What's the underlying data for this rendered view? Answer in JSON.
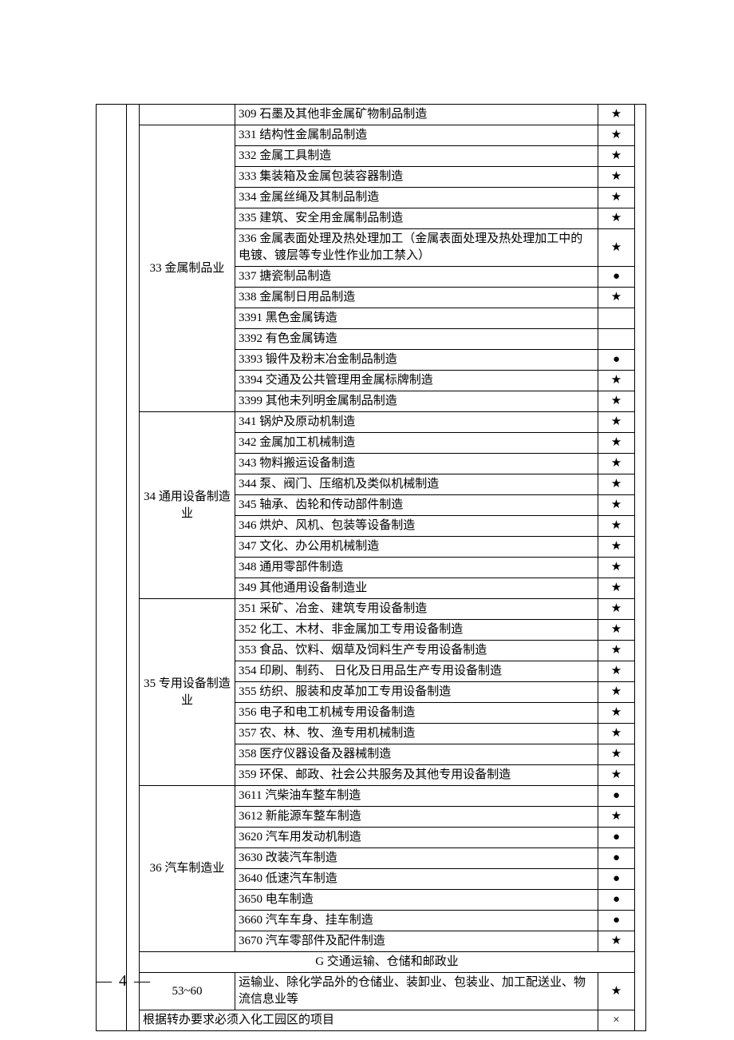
{
  "rows": [
    {
      "cat": "",
      "desc": "309 石墨及其他非金属矿物制品制造",
      "mark": "★"
    }
  ],
  "group33": {
    "label": "33  金属制品业",
    "items": [
      {
        "desc": "331 结构性金属制品制造",
        "mark": "★"
      },
      {
        "desc": "332 金属工具制造",
        "mark": "★"
      },
      {
        "desc": "333 集装箱及金属包装容器制造",
        "mark": "★"
      },
      {
        "desc": "334 金属丝绳及其制品制造",
        "mark": "★"
      },
      {
        "desc": "335 建筑、安全用金属制品制造",
        "mark": "★"
      },
      {
        "desc": "336 金属表面处理及热处理加工（金属表面处理及热处理加工中的电镀、镀层等专业性作业加工禁入）",
        "mark": "★"
      },
      {
        "desc": "337 搪瓷制品制造",
        "mark": "●"
      },
      {
        "desc": "338 金属制日用品制造",
        "mark": "★"
      },
      {
        "desc": "3391 黑色金属铸造",
        "mark": ""
      },
      {
        "desc": "3392 有色金属铸造",
        "mark": ""
      },
      {
        "desc": "3393 锻件及粉末冶金制品制造",
        "mark": "●"
      },
      {
        "desc": "3394 交通及公共管理用金属标牌制造",
        "mark": "★"
      },
      {
        "desc": "3399 其他未列明金属制品制造",
        "mark": "★"
      }
    ]
  },
  "group34": {
    "label": "34 通用设备制造业",
    "items": [
      {
        "desc": "341 锅炉及原动机制造",
        "mark": "★"
      },
      {
        "desc": "342 金属加工机械制造",
        "mark": "★"
      },
      {
        "desc": "343 物料搬运设备制造",
        "mark": "★"
      },
      {
        "desc": "344 泵、阀门、压缩机及类似机械制造",
        "mark": "★"
      },
      {
        "desc": "345 轴承、齿轮和传动部件制造",
        "mark": "★"
      },
      {
        "desc": "346 烘炉、风机、包装等设备制造",
        "mark": "★"
      },
      {
        "desc": "347 文化、办公用机械制造",
        "mark": "★"
      },
      {
        "desc": "348 通用零部件制造",
        "mark": "★"
      },
      {
        "desc": "349 其他通用设备制造业",
        "mark": "★"
      }
    ]
  },
  "group35": {
    "label": "35  专用设备制造业",
    "items": [
      {
        "desc": "351 采矿、冶金、建筑专用设备制造",
        "mark": "★"
      },
      {
        "desc": "352 化工、木材、非金属加工专用设备制造",
        "mark": "★"
      },
      {
        "desc": "353 食品、饮料、烟草及饲料生产专用设备制造",
        "mark": "★"
      },
      {
        "desc": "354 印刷、制药、 日化及日用品生产专用设备制造",
        "mark": "★"
      },
      {
        "desc": "355 纺织、服装和皮革加工专用设备制造",
        "mark": "★"
      },
      {
        "desc": "356 电子和电工机械专用设备制造",
        "mark": "★"
      },
      {
        "desc": "357 农、林、牧、渔专用机械制造",
        "mark": "★"
      },
      {
        "desc": "358 医疗仪器设备及器械制造",
        "mark": "★"
      },
      {
        "desc": "359 环保、邮政、社会公共服务及其他专用设备制造",
        "mark": "★"
      }
    ]
  },
  "group36": {
    "label": "36 汽车制造业",
    "items": [
      {
        "desc": "3611 汽柴油车整车制造",
        "mark": "●"
      },
      {
        "desc": "3612 新能源车整车制造",
        "mark": "★"
      },
      {
        "desc": "3620 汽车用发动机制造",
        "mark": "●"
      },
      {
        "desc": "3630 改装汽车制造",
        "mark": "●"
      },
      {
        "desc": "3640 低速汽车制造",
        "mark": "●"
      },
      {
        "desc": "3650 电车制造",
        "mark": "●"
      },
      {
        "desc": "3660 汽车车身、挂车制造",
        "mark": "●"
      },
      {
        "desc": "3670 汽车零部件及配件制造",
        "mark": "★"
      }
    ]
  },
  "sectionG": "G 交通运输、仓储和邮政业",
  "group53": {
    "label": "53~60",
    "desc": "运输业、除化学品外的仓储业、装卸业、包装业、加工配送业、物流信息业等",
    "mark": "★"
  },
  "footerRow": {
    "desc": "根据转办要求必须入化工园区的项目",
    "mark": "×"
  },
  "pageNum": "—  4  —"
}
